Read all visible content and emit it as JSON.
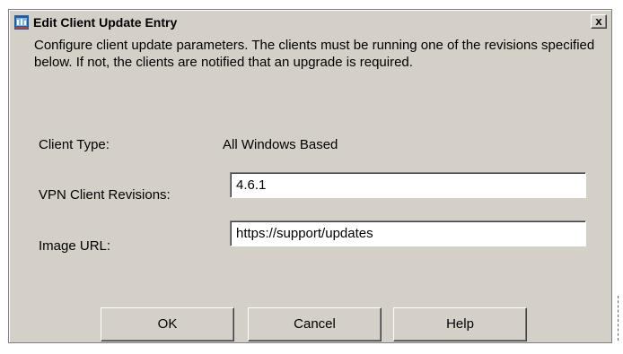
{
  "window": {
    "title": "Edit Client Update Entry",
    "icon": "cisco-app-icon",
    "close_label": "x"
  },
  "description": "Configure client update parameters.  The clients must be running one of the revisions specified below.  If not, the clients are notified that an upgrade is required.",
  "client_type": {
    "label": "Client Type:",
    "value": "All Windows Based"
  },
  "vpn_revisions": {
    "label": "VPN Client Revisions:",
    "value": "4.6.1"
  },
  "image_url": {
    "label": "Image URL:",
    "value": "https://support/updates"
  },
  "buttons": {
    "ok": "OK",
    "cancel": "Cancel",
    "help": "Help"
  }
}
